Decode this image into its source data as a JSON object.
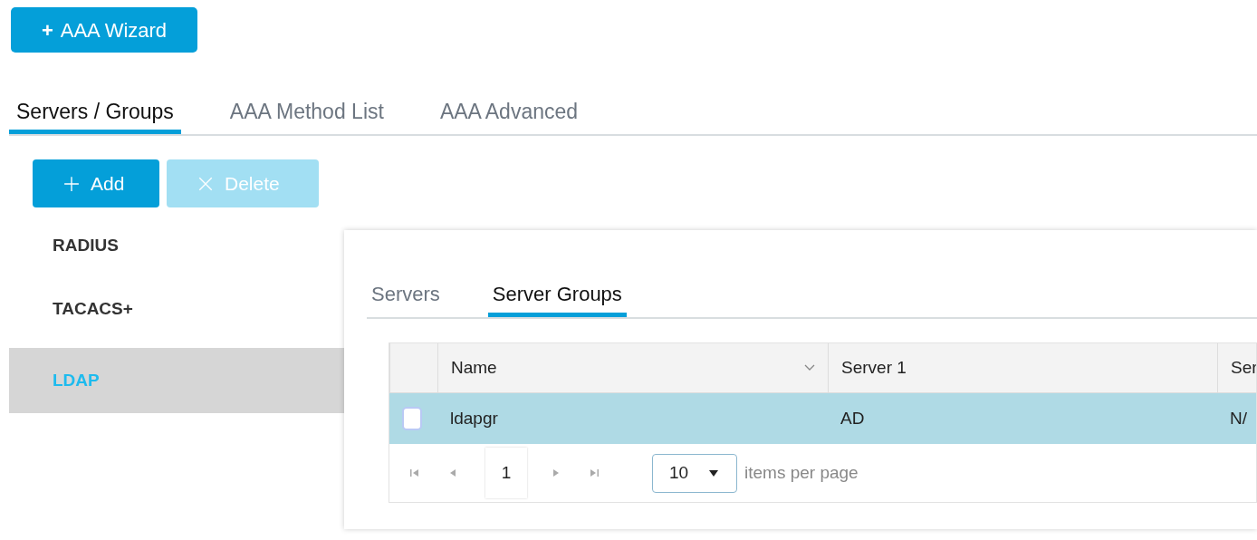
{
  "wizard_button": {
    "icon": "+",
    "label": "AAA Wizard"
  },
  "tabs": [
    {
      "label": "Servers / Groups",
      "selected": true
    },
    {
      "label": "AAA Method List",
      "selected": false
    },
    {
      "label": "AAA Advanced",
      "selected": false
    }
  ],
  "actions": [
    {
      "label": "Add",
      "kind": "add",
      "disabled": false
    },
    {
      "label": "Delete",
      "kind": "delete",
      "disabled": true
    }
  ],
  "sidebar": {
    "items": [
      {
        "label": "RADIUS",
        "selected": false
      },
      {
        "label": "TACACS+",
        "selected": false
      },
      {
        "label": "LDAP",
        "selected": true
      }
    ]
  },
  "panel": {
    "tabs": [
      {
        "label": "Servers",
        "selected": false
      },
      {
        "label": "Server Groups",
        "selected": true
      }
    ],
    "table": {
      "columns": [
        "Name",
        "Server 1",
        "Ser"
      ],
      "rows": [
        {
          "cells": [
            "ldapgr",
            "AD",
            "N/"
          ],
          "selected": true,
          "checked": false
        }
      ]
    },
    "pager": {
      "page": "1",
      "page_size": "10",
      "page_size_label": "items per page"
    }
  }
}
